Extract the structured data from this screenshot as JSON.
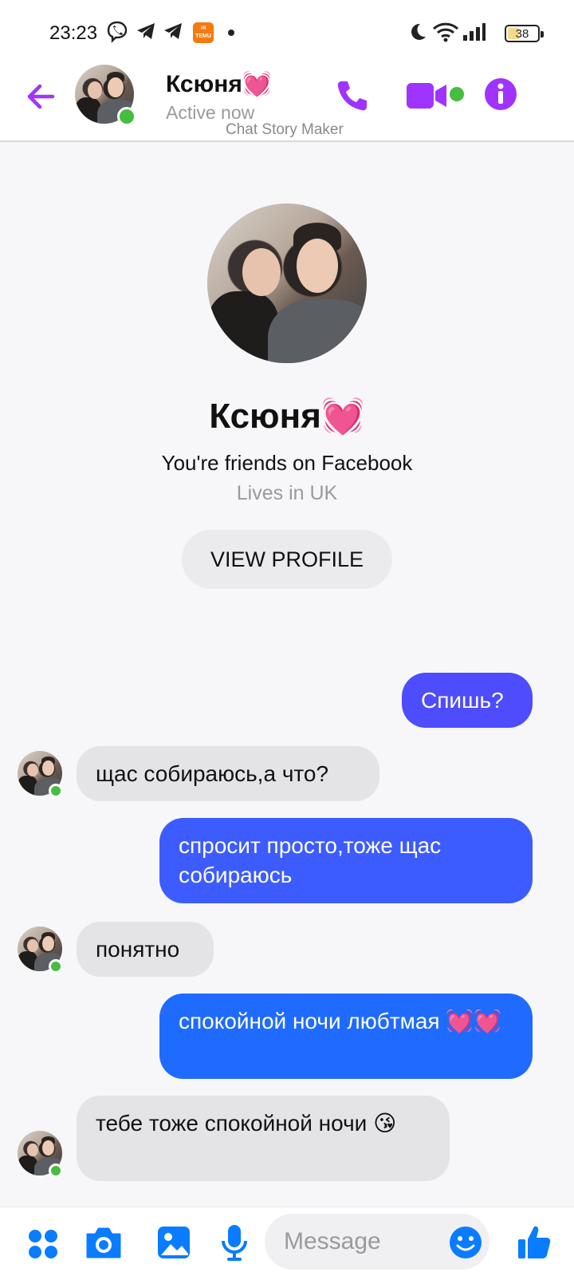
{
  "status_bar": {
    "time": "23:23",
    "battery": "38",
    "battery_level": 0.38,
    "icons": [
      "viber-icon",
      "telegram-icon",
      "telegram-icon",
      "temu-icon",
      "dot",
      "moon-icon",
      "wifi-icon",
      "signal-icon",
      "battery-icon"
    ]
  },
  "header": {
    "name": "Ксюня💓",
    "status": "Active now",
    "watermark": "Chat Story Maker",
    "icons": [
      "back-arrow-icon",
      "phone-icon",
      "video-icon",
      "info-icon"
    ]
  },
  "profile": {
    "name": "Ксюня💓",
    "friends_text": "You're friends on Facebook",
    "lives": "Lives in UK",
    "view_profile": "VIEW PROFILE"
  },
  "messages": [
    {
      "direction": "out",
      "text": "Спишь?"
    },
    {
      "direction": "in",
      "text": "щас собираюсь,а что?"
    },
    {
      "direction": "out",
      "text": "спросит просто,тоже щас собираюсь"
    },
    {
      "direction": "in",
      "text": "понятно"
    },
    {
      "direction": "out",
      "text": "спокойной ночи любтмая 💓💓"
    },
    {
      "direction": "in",
      "text": "тебе тоже спокойной ночи 😘"
    }
  ],
  "composer": {
    "placeholder": "Message",
    "icons": [
      "menu-dots-icon",
      "camera-icon",
      "gallery-icon",
      "microphone-icon",
      "emoji-icon",
      "like-icon"
    ]
  },
  "colors": {
    "accent_purple": "#a033ff",
    "bubble_out_top": "#5a4bff",
    "bubble_out_bottom": "#1f6bff",
    "bubble_in": "#e4e4e7",
    "composer_blue": "#0a7cff",
    "online_green": "#45bd3e"
  }
}
